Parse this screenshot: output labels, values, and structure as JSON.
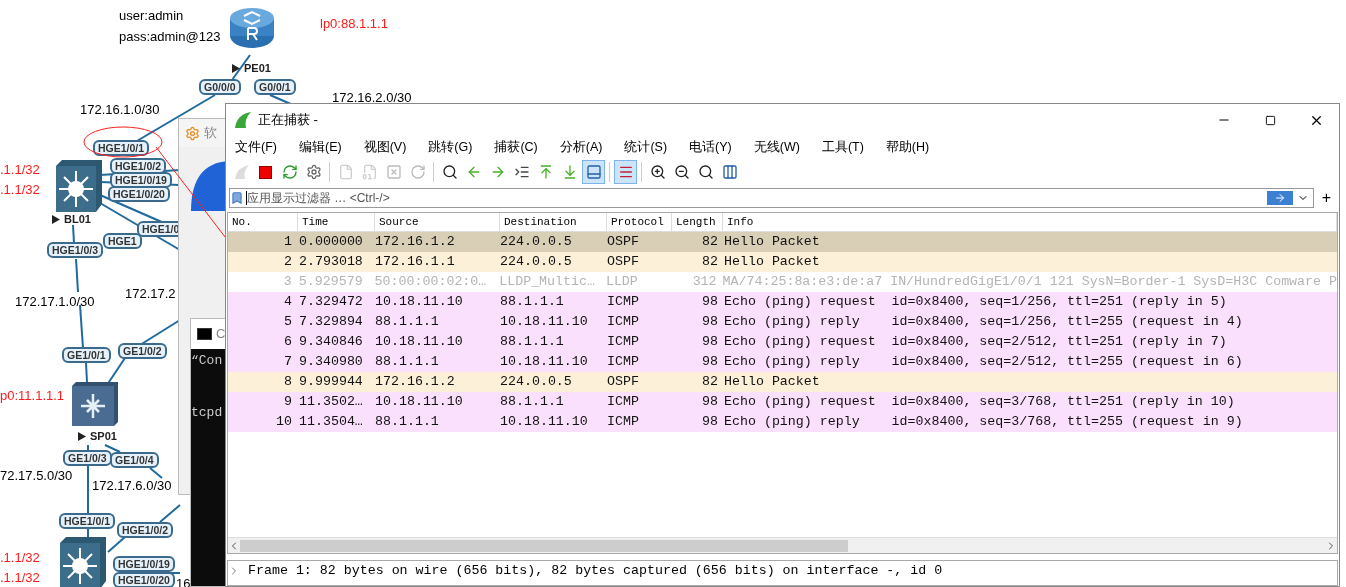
{
  "topology": {
    "credentials": [
      "user:admin",
      "pass:admin@123"
    ],
    "devices": [
      {
        "name": "PE01",
        "kind": "router"
      },
      {
        "name": "BL01",
        "kind": "switch"
      },
      {
        "name": "SP01",
        "kind": "spine"
      },
      {
        "kind": "switch"
      }
    ],
    "loopbacks": [
      "lp0:88.1.1.1",
      ".1.1/32",
      ".1.1/32",
      "p0:11.1.1.1",
      ".1.1/32",
      ".1.1/32"
    ],
    "subnets": [
      "172.16.1.0/30",
      "172.16.2.0/30",
      "172.17.1.0/30",
      "172.17.2",
      "72.17.5.0/30",
      "172.17.6.0/30",
      "16"
    ],
    "ports": [
      "G0/0/0",
      "G0/0/1",
      "HGE1/0/1",
      "HGE1/0/2",
      "HGE1/0/19",
      "HGE1/0/20",
      "HGE1/0",
      "HGE1",
      "HGE1/0/3",
      "GE1/0/1",
      "GE1/0/2",
      "GE1/0/3",
      "GE1/0/4",
      "HGE1/0/1",
      "HGE1/0/2",
      "HGE1/0/19",
      "HGE1/0/20"
    ]
  },
  "background_windows": [
    {
      "kind": "software",
      "title": "软"
    },
    {
      "kind": "console",
      "title": "C",
      "lines": [
        "“Con",
        "tcpd"
      ]
    }
  ],
  "window": {
    "title": "正在捕获 -",
    "menu": [
      "文件(F)",
      "编辑(E)",
      "视图(V)",
      "跳转(G)",
      "捕获(C)",
      "分析(A)",
      "统计(S)",
      "电话(Y)",
      "无线(W)",
      "工具(T)",
      "帮助(H)"
    ],
    "toolbar": [
      {
        "kind": "start",
        "on": false,
        "disabled": true
      },
      {
        "kind": "stop",
        "on": false,
        "disabled": false
      },
      {
        "kind": "restart",
        "on": false,
        "disabled": false
      },
      {
        "kind": "options",
        "on": false,
        "disabled": false
      },
      {
        "kind": "open",
        "on": false,
        "disabled": true
      },
      {
        "kind": "save",
        "on": false,
        "disabled": true
      },
      {
        "kind": "close",
        "on": false,
        "disabled": true
      },
      {
        "kind": "reload",
        "on": false,
        "disabled": true
      },
      {
        "kind": "find",
        "on": false,
        "disabled": false
      },
      {
        "kind": "back",
        "on": false,
        "disabled": false
      },
      {
        "kind": "forward",
        "on": false,
        "disabled": false
      },
      {
        "kind": "goto",
        "on": false,
        "disabled": false
      },
      {
        "kind": "first",
        "on": false,
        "disabled": false
      },
      {
        "kind": "last",
        "on": false,
        "disabled": false
      },
      {
        "kind": "autoscroll",
        "on": true,
        "disabled": false
      },
      {
        "kind": "colorize",
        "on": true,
        "disabled": false
      },
      {
        "kind": "zoom-in",
        "on": false,
        "disabled": false
      },
      {
        "kind": "zoom-out",
        "on": false,
        "disabled": false
      },
      {
        "kind": "zoom-reset",
        "on": false,
        "disabled": false
      },
      {
        "kind": "resize",
        "on": false,
        "disabled": false
      }
    ],
    "filter": {
      "placeholder": "应用显示过滤器 … <Ctrl-/>",
      "add": "+"
    },
    "packet_list": {
      "columns": [
        "No.",
        "Time",
        "Source",
        "Destination",
        "Protocol",
        "Length",
        "Info"
      ],
      "rows": [
        {
          "no": "1",
          "time": "0.000000",
          "source": "172.16.1.2",
          "destination": "224.0.0.5",
          "protocol": "OSPF",
          "length": "82",
          "info": "Hello Packet",
          "selected": true,
          "dimmed": false
        },
        {
          "no": "2",
          "time": "2.793018",
          "source": "172.16.1.1",
          "destination": "224.0.0.5",
          "protocol": "OSPF",
          "length": "82",
          "info": "Hello Packet",
          "color": "#fdf0d8",
          "selected": false,
          "dimmed": false
        },
        {
          "no": "3",
          "time": "5.929579",
          "source": "50:00:00:02:0…",
          "destination": "LLDP_Multic…",
          "protocol": "LLDP",
          "length": "312",
          "info": "MA/74:25:8a:e3:de:a7 IN/HundredGigE1/0/1 121 SysN=Border-1 SysD=H3C Comware P",
          "color": "#ffffff",
          "selected": false,
          "dimmed": true
        },
        {
          "no": "4",
          "time": "7.329472",
          "source": "10.18.11.10",
          "destination": "88.1.1.1",
          "protocol": "ICMP",
          "length": "98",
          "info": "Echo (ping) request  id=0x8400, seq=1/256, ttl=251 (reply in 5)",
          "color": "#fbe0fd",
          "selected": false,
          "dimmed": false
        },
        {
          "no": "5",
          "time": "7.329894",
          "source": "88.1.1.1",
          "destination": "10.18.11.10",
          "protocol": "ICMP",
          "length": "98",
          "info": "Echo (ping) reply    id=0x8400, seq=1/256, ttl=255 (request in 4)",
          "color": "#fbe0fd",
          "selected": false,
          "dimmed": false
        },
        {
          "no": "6",
          "time": "9.340846",
          "source": "10.18.11.10",
          "destination": "88.1.1.1",
          "protocol": "ICMP",
          "length": "98",
          "info": "Echo (ping) request  id=0x8400, seq=2/512, ttl=251 (reply in 7)",
          "color": "#fbe0fd",
          "selected": false,
          "dimmed": false
        },
        {
          "no": "7",
          "time": "9.340980",
          "source": "88.1.1.1",
          "destination": "10.18.11.10",
          "protocol": "ICMP",
          "length": "98",
          "info": "Echo (ping) reply    id=0x8400, seq=2/512, ttl=255 (request in 6)",
          "color": "#fbe0fd",
          "selected": false,
          "dimmed": false
        },
        {
          "no": "8",
          "time": "9.999944",
          "source": "172.16.1.2",
          "destination": "224.0.0.5",
          "protocol": "OSPF",
          "length": "82",
          "info": "Hello Packet",
          "color": "#fdf0d8",
          "selected": false,
          "dimmed": false
        },
        {
          "no": "9",
          "time": "11.3502…",
          "source": "10.18.11.10",
          "destination": "88.1.1.1",
          "protocol": "ICMP",
          "length": "98",
          "info": "Echo (ping) request  id=0x8400, seq=3/768, ttl=251 (reply in 10)",
          "color": "#fbe0fd",
          "selected": false,
          "dimmed": false
        },
        {
          "no": "10",
          "time": "11.3504…",
          "source": "88.1.1.1",
          "destination": "10.18.11.10",
          "protocol": "ICMP",
          "length": "98",
          "info": "Echo (ping) reply    id=0x8400, seq=3/768, ttl=255 (request in 9)",
          "color": "#fbe0fd",
          "selected": false,
          "dimmed": false
        }
      ]
    },
    "details": [
      {
        "text": "Frame 1: 82 bytes on wire (656 bits), 82 bytes captured (656 bits) on interface -, id 0",
        "expanded": false
      }
    ]
  }
}
